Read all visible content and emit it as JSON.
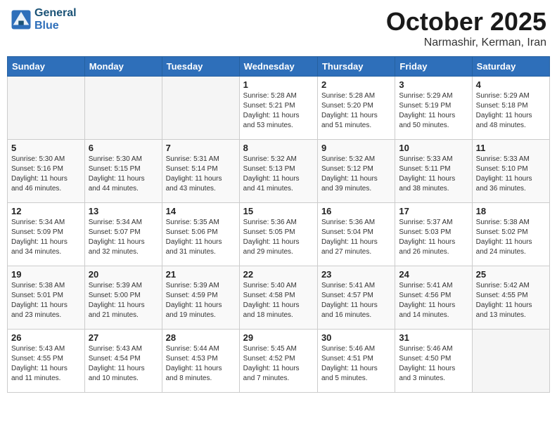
{
  "header": {
    "logo_line1": "General",
    "logo_line2": "Blue",
    "month": "October 2025",
    "location": "Narmashir, Kerman, Iran"
  },
  "weekdays": [
    "Sunday",
    "Monday",
    "Tuesday",
    "Wednesday",
    "Thursday",
    "Friday",
    "Saturday"
  ],
  "weeks": [
    [
      {
        "day": "",
        "info": ""
      },
      {
        "day": "",
        "info": ""
      },
      {
        "day": "",
        "info": ""
      },
      {
        "day": "1",
        "info": "Sunrise: 5:28 AM\nSunset: 5:21 PM\nDaylight: 11 hours\nand 53 minutes."
      },
      {
        "day": "2",
        "info": "Sunrise: 5:28 AM\nSunset: 5:20 PM\nDaylight: 11 hours\nand 51 minutes."
      },
      {
        "day": "3",
        "info": "Sunrise: 5:29 AM\nSunset: 5:19 PM\nDaylight: 11 hours\nand 50 minutes."
      },
      {
        "day": "4",
        "info": "Sunrise: 5:29 AM\nSunset: 5:18 PM\nDaylight: 11 hours\nand 48 minutes."
      }
    ],
    [
      {
        "day": "5",
        "info": "Sunrise: 5:30 AM\nSunset: 5:16 PM\nDaylight: 11 hours\nand 46 minutes."
      },
      {
        "day": "6",
        "info": "Sunrise: 5:30 AM\nSunset: 5:15 PM\nDaylight: 11 hours\nand 44 minutes."
      },
      {
        "day": "7",
        "info": "Sunrise: 5:31 AM\nSunset: 5:14 PM\nDaylight: 11 hours\nand 43 minutes."
      },
      {
        "day": "8",
        "info": "Sunrise: 5:32 AM\nSunset: 5:13 PM\nDaylight: 11 hours\nand 41 minutes."
      },
      {
        "day": "9",
        "info": "Sunrise: 5:32 AM\nSunset: 5:12 PM\nDaylight: 11 hours\nand 39 minutes."
      },
      {
        "day": "10",
        "info": "Sunrise: 5:33 AM\nSunset: 5:11 PM\nDaylight: 11 hours\nand 38 minutes."
      },
      {
        "day": "11",
        "info": "Sunrise: 5:33 AM\nSunset: 5:10 PM\nDaylight: 11 hours\nand 36 minutes."
      }
    ],
    [
      {
        "day": "12",
        "info": "Sunrise: 5:34 AM\nSunset: 5:09 PM\nDaylight: 11 hours\nand 34 minutes."
      },
      {
        "day": "13",
        "info": "Sunrise: 5:34 AM\nSunset: 5:07 PM\nDaylight: 11 hours\nand 32 minutes."
      },
      {
        "day": "14",
        "info": "Sunrise: 5:35 AM\nSunset: 5:06 PM\nDaylight: 11 hours\nand 31 minutes."
      },
      {
        "day": "15",
        "info": "Sunrise: 5:36 AM\nSunset: 5:05 PM\nDaylight: 11 hours\nand 29 minutes."
      },
      {
        "day": "16",
        "info": "Sunrise: 5:36 AM\nSunset: 5:04 PM\nDaylight: 11 hours\nand 27 minutes."
      },
      {
        "day": "17",
        "info": "Sunrise: 5:37 AM\nSunset: 5:03 PM\nDaylight: 11 hours\nand 26 minutes."
      },
      {
        "day": "18",
        "info": "Sunrise: 5:38 AM\nSunset: 5:02 PM\nDaylight: 11 hours\nand 24 minutes."
      }
    ],
    [
      {
        "day": "19",
        "info": "Sunrise: 5:38 AM\nSunset: 5:01 PM\nDaylight: 11 hours\nand 23 minutes."
      },
      {
        "day": "20",
        "info": "Sunrise: 5:39 AM\nSunset: 5:00 PM\nDaylight: 11 hours\nand 21 minutes."
      },
      {
        "day": "21",
        "info": "Sunrise: 5:39 AM\nSunset: 4:59 PM\nDaylight: 11 hours\nand 19 minutes."
      },
      {
        "day": "22",
        "info": "Sunrise: 5:40 AM\nSunset: 4:58 PM\nDaylight: 11 hours\nand 18 minutes."
      },
      {
        "day": "23",
        "info": "Sunrise: 5:41 AM\nSunset: 4:57 PM\nDaylight: 11 hours\nand 16 minutes."
      },
      {
        "day": "24",
        "info": "Sunrise: 5:41 AM\nSunset: 4:56 PM\nDaylight: 11 hours\nand 14 minutes."
      },
      {
        "day": "25",
        "info": "Sunrise: 5:42 AM\nSunset: 4:55 PM\nDaylight: 11 hours\nand 13 minutes."
      }
    ],
    [
      {
        "day": "26",
        "info": "Sunrise: 5:43 AM\nSunset: 4:55 PM\nDaylight: 11 hours\nand 11 minutes."
      },
      {
        "day": "27",
        "info": "Sunrise: 5:43 AM\nSunset: 4:54 PM\nDaylight: 11 hours\nand 10 minutes."
      },
      {
        "day": "28",
        "info": "Sunrise: 5:44 AM\nSunset: 4:53 PM\nDaylight: 11 hours\nand 8 minutes."
      },
      {
        "day": "29",
        "info": "Sunrise: 5:45 AM\nSunset: 4:52 PM\nDaylight: 11 hours\nand 7 minutes."
      },
      {
        "day": "30",
        "info": "Sunrise: 5:46 AM\nSunset: 4:51 PM\nDaylight: 11 hours\nand 5 minutes."
      },
      {
        "day": "31",
        "info": "Sunrise: 5:46 AM\nSunset: 4:50 PM\nDaylight: 11 hours\nand 3 minutes."
      },
      {
        "day": "",
        "info": ""
      }
    ]
  ]
}
